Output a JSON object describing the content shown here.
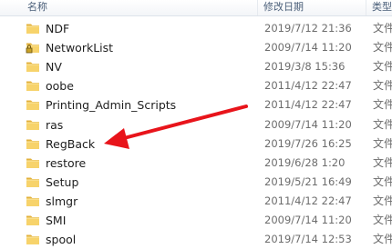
{
  "columns": {
    "name": "名称",
    "date": "修改日期",
    "type": "类型"
  },
  "folders": [
    {
      "name": "NDF",
      "date": "2019/7/12 21:36",
      "type": "文件",
      "locked": false
    },
    {
      "name": "NetworkList",
      "date": "2009/7/14 11:20",
      "type": "文件",
      "locked": true
    },
    {
      "name": "NV",
      "date": "2019/3/8 15:36",
      "type": "文件",
      "locked": false
    },
    {
      "name": "oobe",
      "date": "2011/4/12 22:47",
      "type": "文件",
      "locked": false
    },
    {
      "name": "Printing_Admin_Scripts",
      "date": "2011/4/12 22:47",
      "type": "文件",
      "locked": false
    },
    {
      "name": "ras",
      "date": "2009/7/14 11:20",
      "type": "文件",
      "locked": false
    },
    {
      "name": "RegBack",
      "date": "2019/7/26 16:25",
      "type": "文件",
      "locked": false
    },
    {
      "name": "restore",
      "date": "2019/6/28 1:20",
      "type": "文件",
      "locked": false
    },
    {
      "name": "Setup",
      "date": "2019/5/21 16:49",
      "type": "文件",
      "locked": false
    },
    {
      "name": "slmgr",
      "date": "2011/4/12 22:47",
      "type": "文件",
      "locked": false
    },
    {
      "name": "SMI",
      "date": "2009/7/14 11:20",
      "type": "文件",
      "locked": false
    },
    {
      "name": "spool",
      "date": "2019/7/14 12:53",
      "type": "文件",
      "locked": false
    }
  ],
  "annotation": {
    "color": "#e8141b",
    "target": "RegBack"
  },
  "icons": {
    "folder": "folder-icon",
    "locked_folder": "locked-folder-icon"
  }
}
